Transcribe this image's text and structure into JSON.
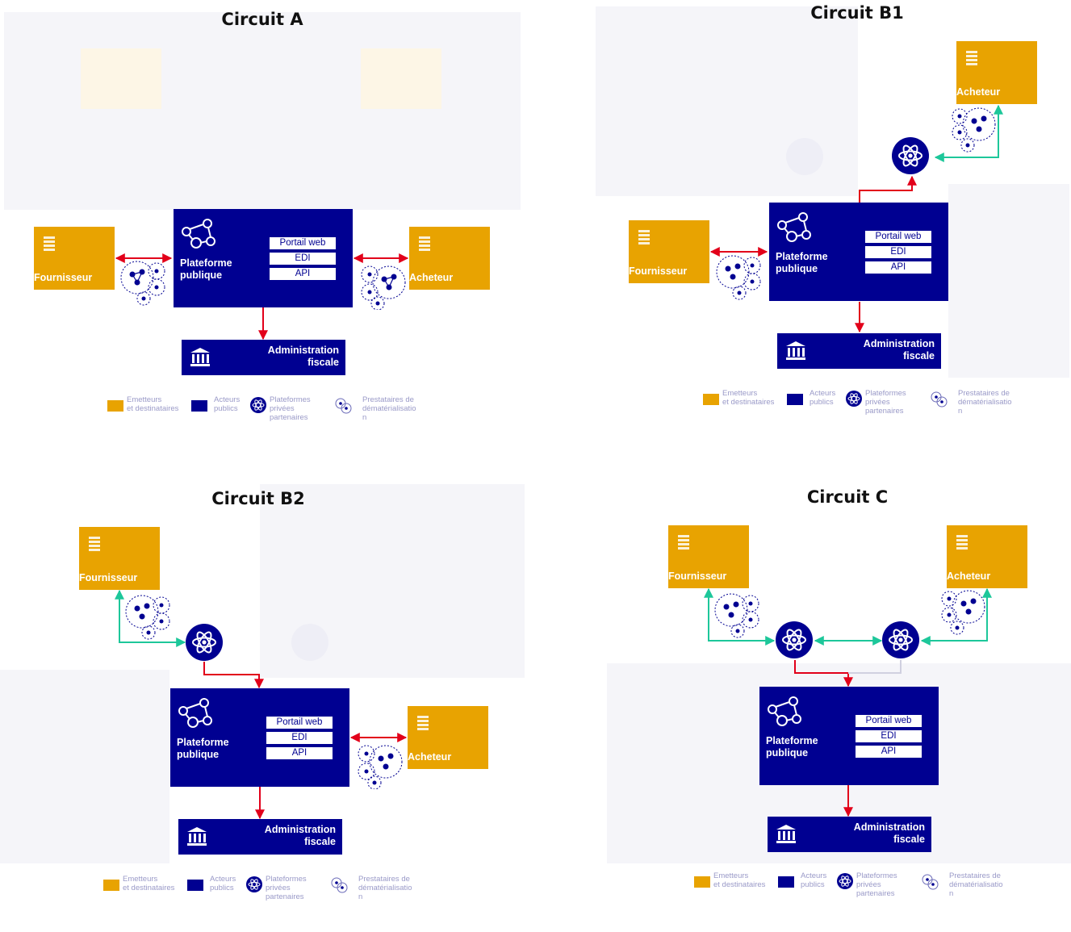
{
  "labels": {
    "fournisseur": "Fournisseur",
    "acheteur": "Acheteur",
    "plateforme_line1": "Plateforme",
    "plateforme_line2": "publique",
    "admin_line1": "Administration",
    "admin_line2": "fiscale",
    "channels": [
      "Portail web",
      "EDI",
      "API"
    ]
  },
  "legend": {
    "emetteurs_1": "Emetteurs",
    "emetteurs_2": "et destinataires",
    "acteurs_1": "Acteurs",
    "acteurs_2": "publics",
    "plateformes_1": "Plateformes",
    "plateformes_2": "privées",
    "plateformes_3": "partenaires",
    "prestataires_1": "Prestataires de",
    "prestataires_2": "dématérialisatio",
    "prestataires_3": "n"
  },
  "panels": [
    {
      "id": "A",
      "title": "Circuit A"
    },
    {
      "id": "B1",
      "title": "Circuit B1"
    },
    {
      "id": "B2",
      "title": "Circuit B2"
    },
    {
      "id": "C",
      "title": "Circuit C"
    }
  ],
  "colors": {
    "supplier_buyer": "#e8a301",
    "public_actor": "#000091",
    "public_flow": "#e2001a",
    "private_flow": "#1dc79a"
  }
}
